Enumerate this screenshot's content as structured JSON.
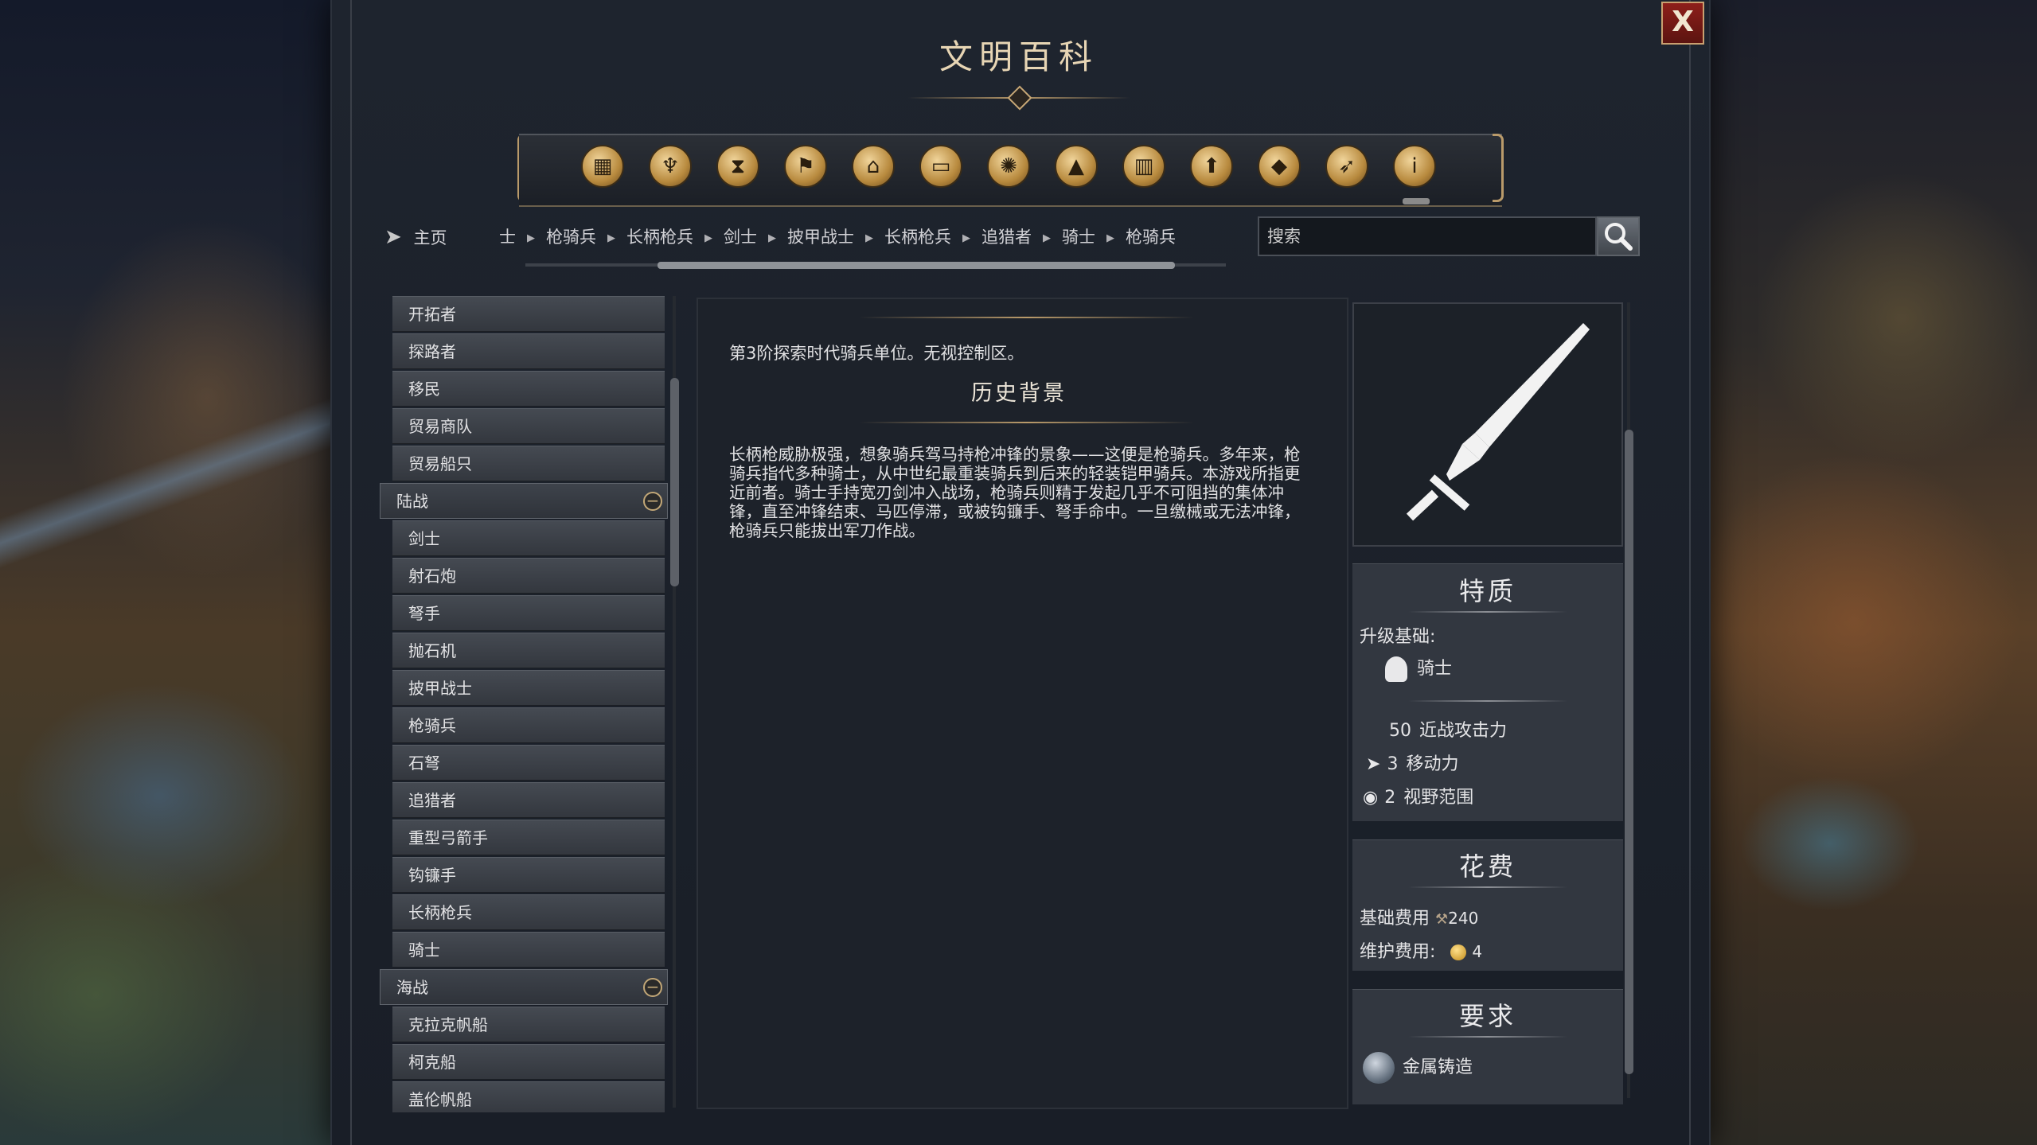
{
  "window": {
    "title": "文明百科",
    "close_label": "X"
  },
  "categories": [
    {
      "icon": "crates-icon"
    },
    {
      "icon": "goblet-icon"
    },
    {
      "icon": "hourglass-icon"
    },
    {
      "icon": "flag-icon"
    },
    {
      "icon": "temple-icon"
    },
    {
      "icon": "book-icon"
    },
    {
      "icon": "atom-icon"
    },
    {
      "icon": "mountain-icon"
    },
    {
      "icon": "building-icon"
    },
    {
      "icon": "up-arrow-icon"
    },
    {
      "icon": "terrain-tile-icon"
    },
    {
      "icon": "dove-icon"
    },
    {
      "icon": "info-icon"
    }
  ],
  "nav": {
    "home_label": "主页",
    "breadcrumb": [
      "战士",
      "枪骑兵",
      "长柄枪兵",
      "剑士",
      "披甲战士",
      "长柄枪兵",
      "追猎者",
      "骑士",
      "枪骑兵"
    ]
  },
  "search": {
    "placeholder": "搜索"
  },
  "unit_list": {
    "items_top": [
      "开拓者",
      "探路者",
      "移民",
      "贸易商队",
      "贸易船只"
    ],
    "group_land": "陆战",
    "items_land": [
      "剑士",
      "射石炮",
      "弩手",
      "抛石机",
      "披甲战士",
      "枪骑兵",
      "石弩",
      "追猎者",
      "重型弓箭手",
      "钩镰手",
      "长柄枪兵",
      "骑士"
    ],
    "group_naval": "海战",
    "items_naval": [
      "克拉克帆船",
      "柯克船",
      "盖伦帆船"
    ],
    "collapse_symbol": "−"
  },
  "article": {
    "description": "第3阶探索时代骑兵单位。无视控制区。",
    "history_heading": "历史背景",
    "history_body": "长柄枪威胁极强，想象骑兵驾马持枪冲锋的景象——这便是枪骑兵。多年来，枪骑兵指代多种骑士，从中世纪最重装骑兵到后来的轻装铠甲骑兵。本游戏所指更近前者。骑士手持宽刃剑冲入战场，枪骑兵则精于发起几乎不可阻挡的集体冲锋，直至冲锋结束、马匹停滞，或被钩镰手、弩手命中。一旦缴械或无法冲锋，枪骑兵只能拔出军刀作战。"
  },
  "traits": {
    "title": "特质",
    "upgrade_label": "升级基础:",
    "upgrade_unit": "骑士",
    "upgrade_icon": "knight-helmet-icon",
    "stats": [
      {
        "value": "50",
        "label": "近战攻击力",
        "icon": ""
      },
      {
        "value": "3",
        "label": "移动力",
        "icon": "movement-arrow-icon"
      },
      {
        "value": "2",
        "label": "视野范围",
        "icon": "eye-icon"
      }
    ]
  },
  "cost": {
    "title": "花费",
    "base_label": "基础费用",
    "base_value": "240",
    "base_icon": "hammer-icon",
    "upkeep_label": "维护费用:",
    "upkeep_value": "4",
    "upkeep_icon": "gold-coin-icon"
  },
  "requirements": {
    "title": "要求",
    "tech": "金属铸造",
    "tech_icon": "metal-casting-icon"
  },
  "colors": {
    "accent_gold": "#c7a877",
    "close_red": "#8e1f1a",
    "panel_bg": "#1e242e"
  }
}
